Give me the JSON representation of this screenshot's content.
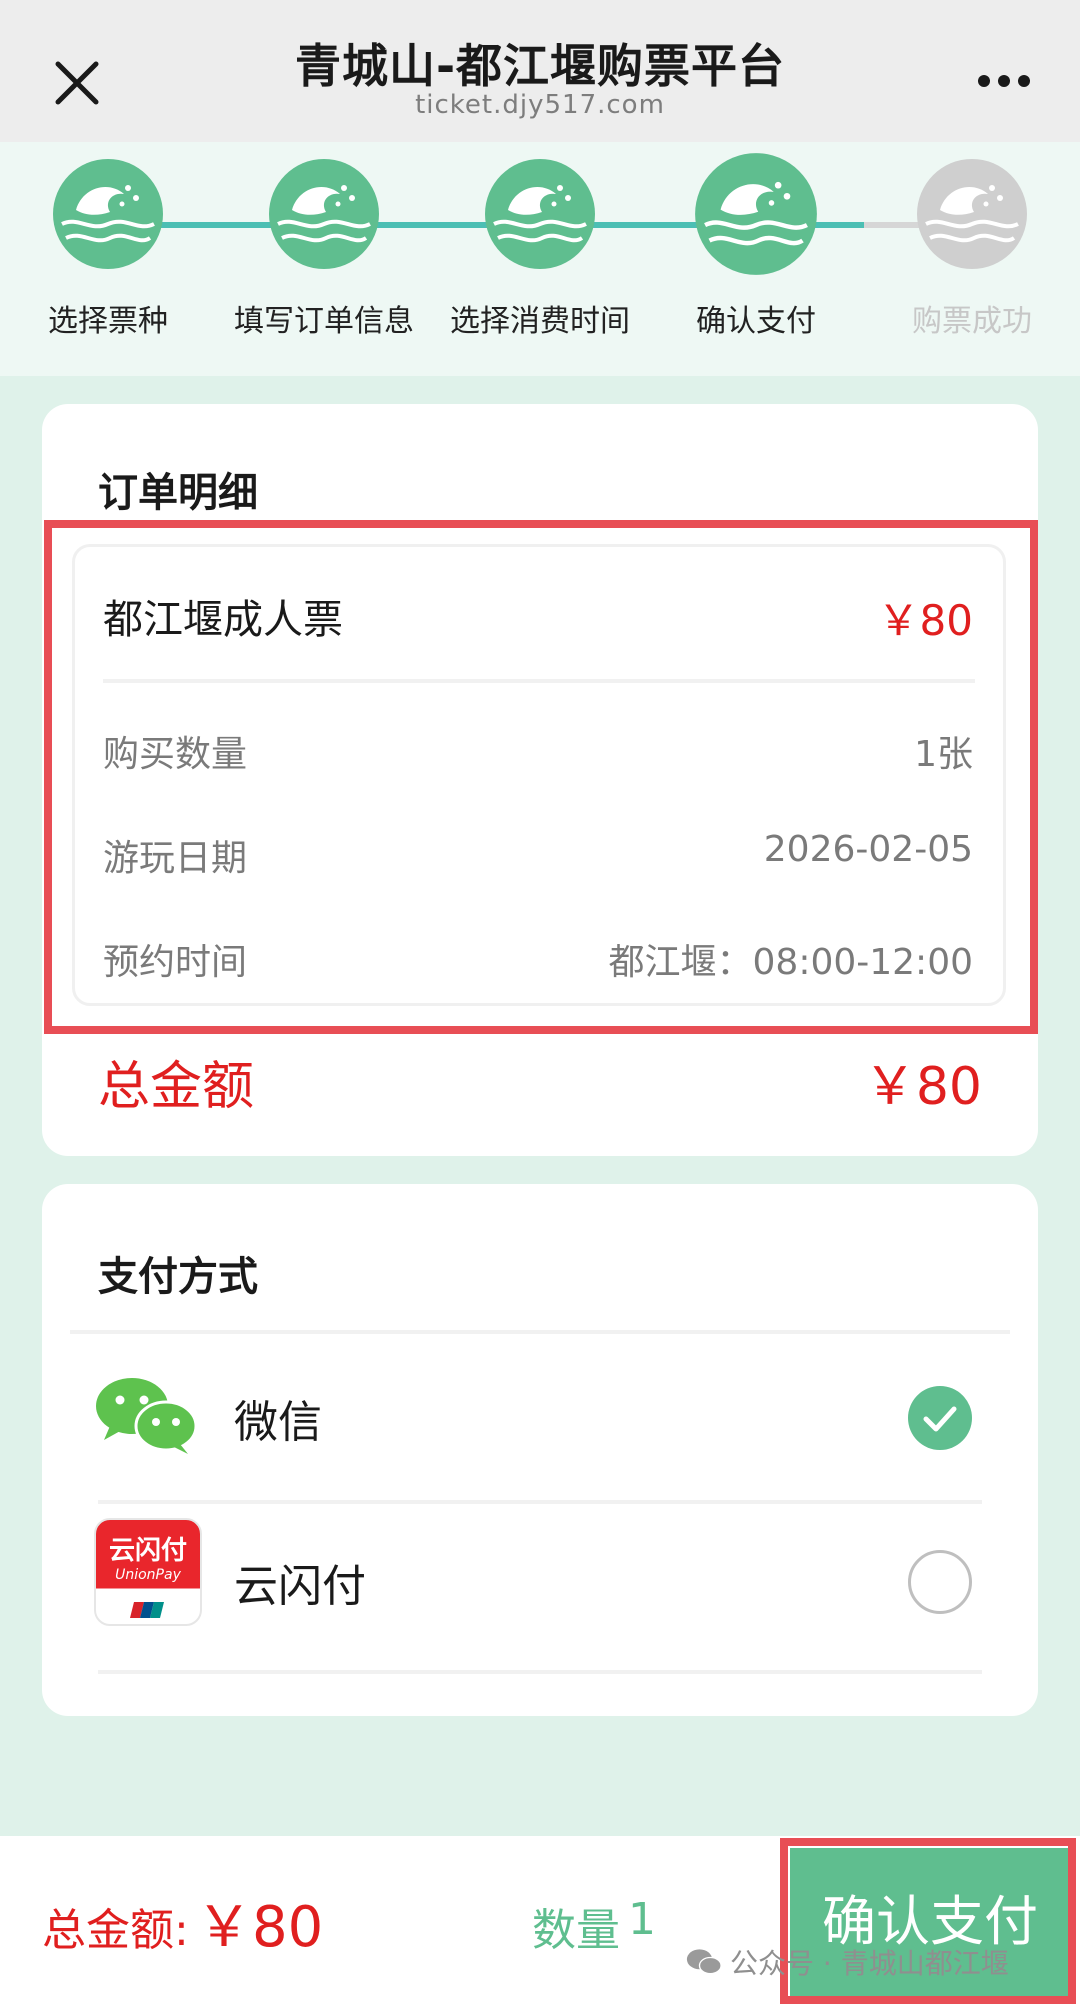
{
  "header": {
    "title": "青城山-都江堰购票平台",
    "subtitle": "ticket.djy517.com",
    "close_icon": "close-icon",
    "more_icon": "more-dots-icon"
  },
  "steps": [
    {
      "label": "选择票种",
      "state": "done"
    },
    {
      "label": "填写订单信息",
      "state": "done"
    },
    {
      "label": "选择消费时间",
      "state": "done"
    },
    {
      "label": "确认支付",
      "state": "current"
    },
    {
      "label": "购票成功",
      "state": "inactive"
    }
  ],
  "order": {
    "title": "订单明细",
    "ticket_name": "都江堰成人票",
    "ticket_price": "￥80",
    "rows": [
      {
        "label": "购买数量",
        "value": "1张"
      },
      {
        "label": "游玩日期",
        "value": "2026-02-05"
      },
      {
        "label": "预约时间",
        "value": "都江堰：08:00-12:00"
      }
    ],
    "total_label": "总金额",
    "total_value": "￥80"
  },
  "payment": {
    "title": "支付方式",
    "methods": [
      {
        "name": "微信",
        "icon": "wechat-icon",
        "selected": true
      },
      {
        "name": "云闪付",
        "icon": "unionpay-icon",
        "selected": false,
        "logo_text": "云闪付",
        "logo_subtext": "UnionPay"
      }
    ]
  },
  "bottom": {
    "total_label": "总金额:",
    "total_value": "￥80",
    "qty_label": "数量",
    "qty_value": "1",
    "confirm_label": "确认支付"
  },
  "watermark": "公众号 · 青城山都江堰",
  "colors": {
    "accent": "#5fbe8f",
    "price": "#e01f1f",
    "highlight": "#e84e55",
    "background": "#dff2ea"
  }
}
